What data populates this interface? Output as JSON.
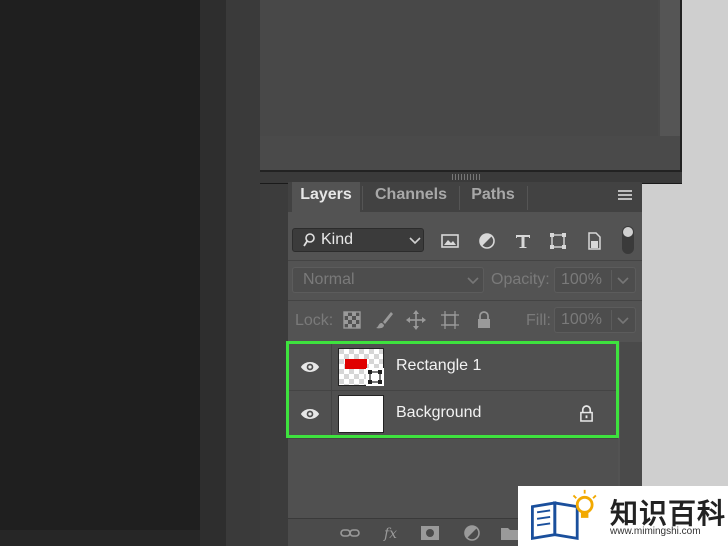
{
  "tabs": [
    {
      "label": "Layers",
      "active": true
    },
    {
      "label": "Channels",
      "active": false
    },
    {
      "label": "Paths",
      "active": false
    }
  ],
  "filter": {
    "kind_label": "Kind",
    "icons": [
      "image-filter-icon",
      "adjustment-filter-icon",
      "type-filter-icon",
      "shape-filter-icon",
      "smart-object-filter-icon"
    ]
  },
  "blend": {
    "mode": "Normal",
    "opacity_label": "Opacity:",
    "opacity_value": "100%"
  },
  "lock": {
    "label": "Lock:",
    "fill_label": "Fill:",
    "fill_value": "100%"
  },
  "layers": [
    {
      "name": "Rectangle 1",
      "visible": true,
      "locked": false
    },
    {
      "name": "Background",
      "visible": true,
      "locked": true
    }
  ],
  "watermark": {
    "text": "知识百科",
    "url": "www.mimingshi.com"
  },
  "colors": {
    "highlight": "#3ee23e",
    "rectangle_fill": "#e00000"
  }
}
